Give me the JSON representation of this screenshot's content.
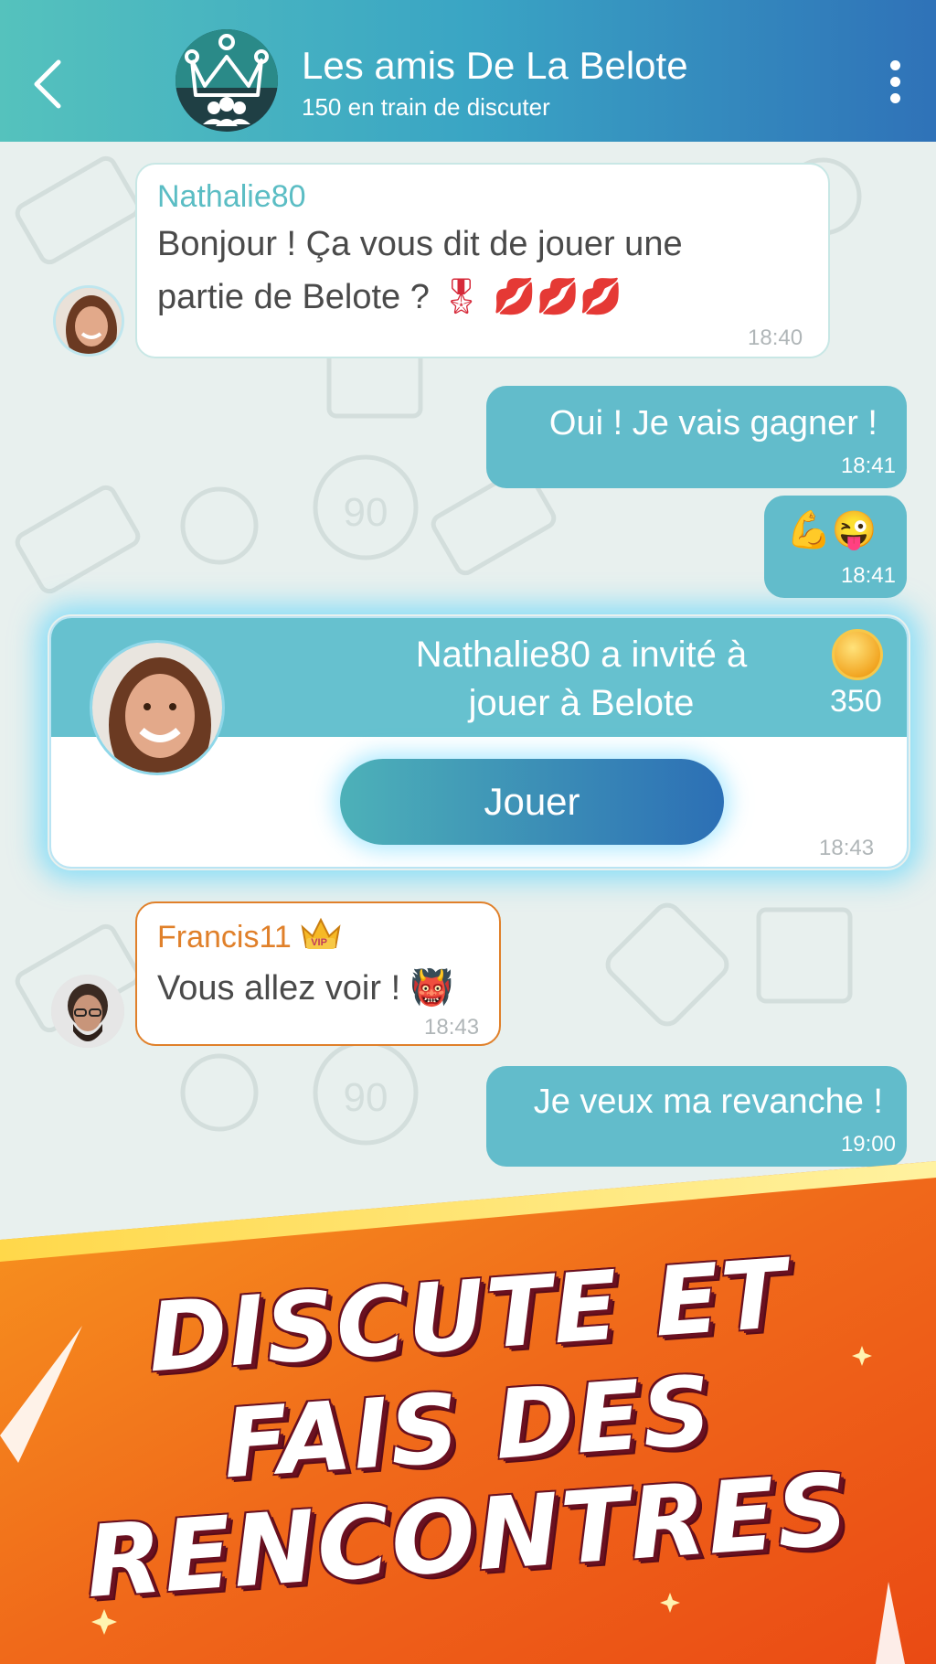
{
  "header": {
    "title": "Les amis De La Belote",
    "subtitle": "150 en train de discuter"
  },
  "messages": [
    {
      "sender": "Nathalie80",
      "text": "Bonjour ! Ça vous dit de jouer une partie de Belote ? 🎖 💋💋💋",
      "line1": "Bonjour ! Ça vous dit de jouer une",
      "line2": "partie de Belote ?",
      "emoji": "🎖 💋💋💋",
      "time": "18:40",
      "direction": "in"
    },
    {
      "text": "Oui ! Je vais gagner !",
      "time": "18:41",
      "direction": "out"
    },
    {
      "text": "💪😜",
      "time": "18:41",
      "direction": "out"
    },
    {
      "sender": "Francis11",
      "badge": "VIP",
      "text": "Vous allez voir !",
      "emoji": "👹",
      "time": "18:43",
      "direction": "in"
    },
    {
      "text": "Je veux ma revanche !",
      "time": "19:00",
      "direction": "out"
    }
  ],
  "invite": {
    "line1": "Nathalie80 a invité à",
    "line2": "jouer à Belote",
    "cost": "350",
    "button": "Jouer",
    "time": "18:43"
  },
  "banner": {
    "line1": "DISCUTE ET",
    "line2": "FAIS DES",
    "line3": "RENCONTRES"
  },
  "colors": {
    "header_start": "#55c2bd",
    "header_end": "#2f72b8",
    "bubble_out": "#62bccb",
    "sender_teal": "#5bbdc4",
    "sender_orange": "#e0802a",
    "banner_orange": "#f06a12"
  }
}
